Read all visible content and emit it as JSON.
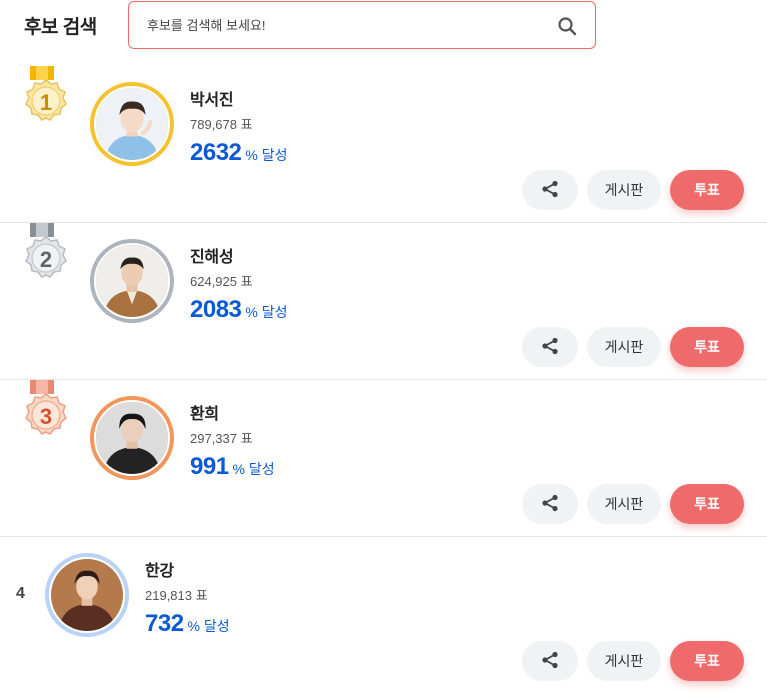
{
  "header": {
    "title": "후보 검색",
    "search_placeholder": "후보를 검색해 보세요!"
  },
  "candidates": [
    {
      "rank": "1",
      "name": "박서진",
      "votes": "789,678 표",
      "percent": "2632",
      "percent_suffix": "% 달성",
      "ring_color": "#f5c232"
    },
    {
      "rank": "2",
      "name": "진해성",
      "votes": "624,925 표",
      "percent": "2083",
      "percent_suffix": "% 달성",
      "ring_color": "#aeb4bb"
    },
    {
      "rank": "3",
      "name": "환희",
      "votes": "297,337 표",
      "percent": "991",
      "percent_suffix": "% 달성",
      "ring_color": "#f2965e"
    },
    {
      "rank": "4",
      "name": "한강",
      "votes": "219,813 표",
      "percent": "732",
      "percent_suffix": "% 달성",
      "ring_color": "#b9d3f7"
    }
  ],
  "actions": {
    "share_icon": "share-icon",
    "board_label": "게시판",
    "vote_label": "투표"
  },
  "colors": {
    "accent": "#ef6b6b",
    "percent": "#0a5ad8",
    "gold": "#f5c232",
    "silver": "#aeb4bb",
    "bronze": "#f2965e"
  }
}
